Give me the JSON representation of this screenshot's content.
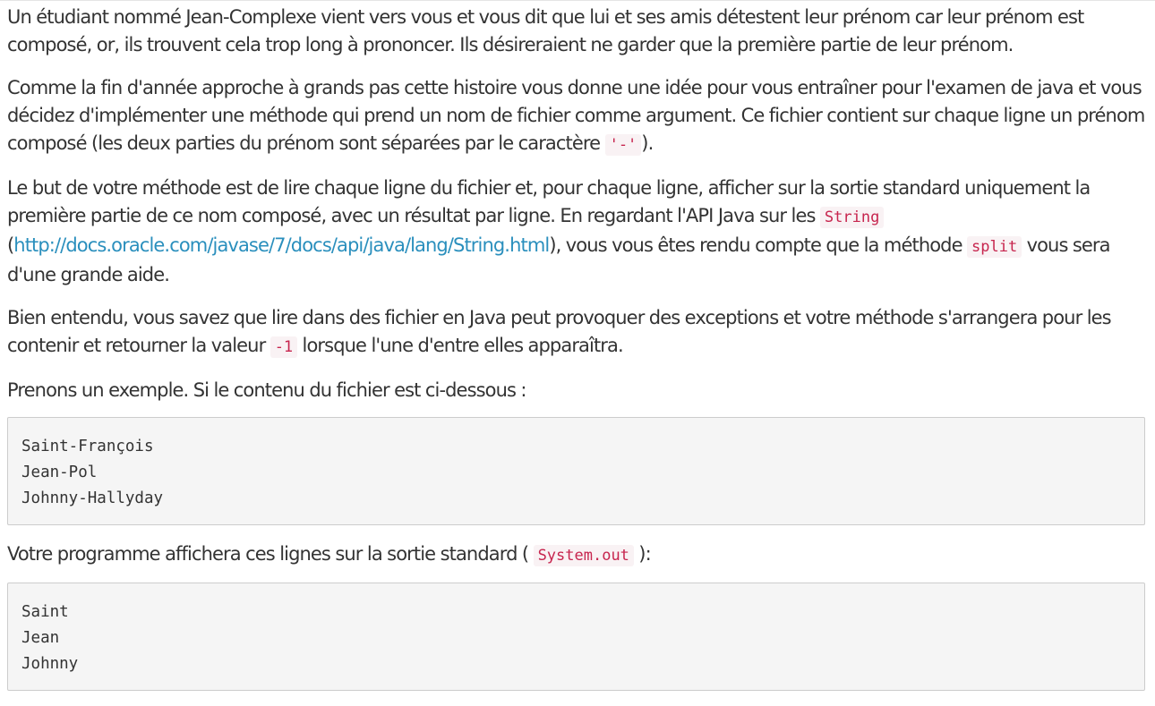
{
  "paragraphs": {
    "p1": "Un étudiant nommé Jean-Complexe vient vers vous et vous dit que lui et ses amis détestent leur prénom car leur prénom est composé, or, ils trouvent cela trop long à prononcer. Ils désireraient ne garder que la première partie de leur prénom.",
    "p2_text": "Comme la fin d'année approche à grands pas cette histoire vous donne une idée pour vous entraîner pour l'examen de java et vous décidez d'implémenter une méthode qui prend un nom de fichier comme argument. Ce fichier contient sur chaque ligne un prénom composé (les deux parties du prénom sont séparées par le caractère ",
    "p2_code": "'-'",
    "p2_end": ").",
    "p3_a": "Le but de votre méthode est de lire chaque ligne du fichier et, pour chaque ligne, afficher sur la sortie standard uniquement la première partie de ce nom composé, avec un résultat par ligne. En regardant l'API Java sur les ",
    "p3_code1": "String",
    "p3_b": " (",
    "p3_link": "http://docs.oracle.com/javase/7/docs/api/java/lang/String.html",
    "p3_c": "), vous vous êtes rendu compte que la méthode ",
    "p3_code2": "split",
    "p3_d": " vous sera d'une grande aide.",
    "p4_a": "Bien entendu, vous savez que lire dans des fichier en Java peut provoquer des exceptions et votre méthode s'arrangera pour les contenir et retourner la valeur ",
    "p4_code": "-1",
    "p4_b": " lorsque l'une d'entre elles apparaîtra.",
    "p5": "Prenons un exemple. Si le contenu du fichier est ci-dessous :",
    "p6_a": "Votre programme affichera ces lignes sur la sortie standard ( ",
    "p6_code": "System.out",
    "p6_b": " ):"
  },
  "code_blocks": {
    "input_lines": [
      "Saint-François",
      "Jean-Pol",
      "Johnny-Hallyday"
    ],
    "output_lines": [
      "Saint",
      "Jean",
      "Johnny"
    ]
  }
}
